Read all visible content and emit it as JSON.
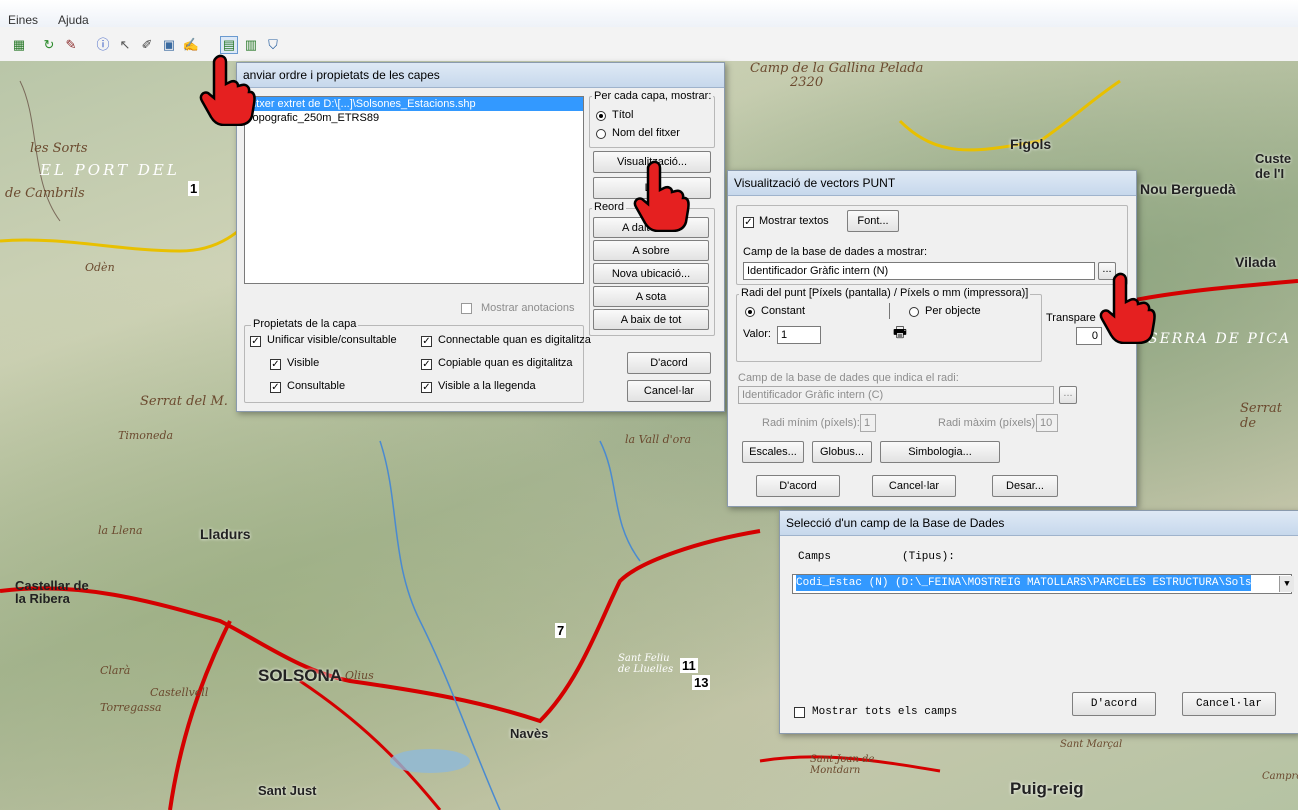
{
  "menu": {
    "items": [
      "Eines",
      "Ajuda"
    ]
  },
  "toolbar": {
    "icons": [
      "layers-icon",
      "refresh-icon",
      "tools-icon",
      "info-icon",
      "pointer-icon",
      "draw-icon",
      "image-icon",
      "edit-icon",
      "layer-order-icon",
      "table-icon",
      "filter-icon"
    ]
  },
  "map": {
    "labels": [
      "Camp de la Gallina Pelada",
      "2320",
      "Figols",
      "Nou Berguedà",
      "Custe de l'I",
      "les Sorts",
      "EL PORT DEL",
      "de Cambrils",
      "Odèn",
      "Vilada",
      "SERRA DE PICA",
      "Serrat del M.",
      "Timoneda",
      "la Vall d'ora",
      "Serrat de",
      "Lladurs",
      "Castellar de la Ribera",
      "SOLSONA",
      "Navès",
      "Sant Just",
      "Puig-reig",
      "Sant Feliu de Lluelles",
      "Olius",
      "la Llena",
      "Torregassa",
      "Castellvell",
      "Clarà",
      "Sant Joan de Montdarn",
      "Sant Marçal",
      "Camprodon"
    ],
    "numbers": [
      "1",
      "7",
      "11",
      "13"
    ]
  },
  "layers_dialog": {
    "title": "anviar ordre i propietats de les capes",
    "layers": [
      "Fitxer extret de D:\\[...]\\Solsones_Estacions.shp",
      "Topografic_250m_ETRS89"
    ],
    "show_group": {
      "caption": "Per cada capa, mostrar:",
      "options": [
        "Títol",
        "Nom del fitxer"
      ],
      "selected": 0
    },
    "visualitzacio_button": "Visualització...",
    "llegenda_button": "Lle",
    "reorder_group": {
      "caption": "Reord",
      "buttons": [
        "A dalt de tot",
        "A sobre",
        "Nova ubicació...",
        "A sota",
        "A baix de tot"
      ]
    },
    "show_annotations": "Mostrar anotacions",
    "props_group": {
      "caption": "Propietats de la capa",
      "items": [
        {
          "label": "Unificar visible/consultable",
          "checked": true
        },
        {
          "label": "Connectable quan es digitalitza",
          "checked": true
        },
        {
          "label": "Visible",
          "checked": true
        },
        {
          "label": "Copiable quan es digitalitza",
          "checked": true
        },
        {
          "label": "Consultable",
          "checked": true
        },
        {
          "label": "Visible a la llegenda",
          "checked": true
        }
      ]
    },
    "ok_button": "D'acord",
    "cancel_button": "Cancel·lar"
  },
  "point_dialog": {
    "title": "Visualització de vectors PUNT",
    "show_texts": "Mostrar textos",
    "show_texts_checked": true,
    "font_button": "Font...",
    "field_label": "Camp de la base de dades a mostrar:",
    "field_value": "Identificador Gràfic intern  (N)",
    "browse_button": "...",
    "radius_group": {
      "caption": "Radi del punt  [Píxels (pantalla) / Píxels o mm (impressora)]",
      "options": [
        "Constant",
        "Per objecte"
      ],
      "selected": 0,
      "value_label": "Valor:",
      "value": "1"
    },
    "transparency_label": "Transpare",
    "transparency_value": "0",
    "radius_field_label": "Camp de la base de dades que indica el radi:",
    "radius_field_value": "Identificador Gràfic intern  (C)",
    "radius_min_label": "Radi mínim (píxels):",
    "radius_min_value": "1",
    "radius_max_label": "Radi màxim (píxels):",
    "radius_max_value": "10",
    "scales_button": "Escales...",
    "globus_button": "Globus...",
    "symbology_button": "Simbologia...",
    "ok_button": "D'acord",
    "cancel_button": "Cancel·lar",
    "save_button": "Desar..."
  },
  "field_dialog": {
    "title": "Selecció d'un camp de la Base de Dades",
    "header_camps": "Camps",
    "header_tipus": "(Tipus):",
    "selected_value": "Codi_Estac (N)  (D:\\_FEINA\\MOSTREIG MATOLLARS\\PARCELES ESTRUCTURA\\Sols",
    "show_all": "Mostrar tots els camps",
    "show_all_checked": false,
    "ok_button": "D'acord",
    "cancel_button": "Cancel·lar"
  },
  "colors": {
    "selection": "#3399ff",
    "road": "#d40000",
    "titlebar": "#c7d8ec"
  }
}
